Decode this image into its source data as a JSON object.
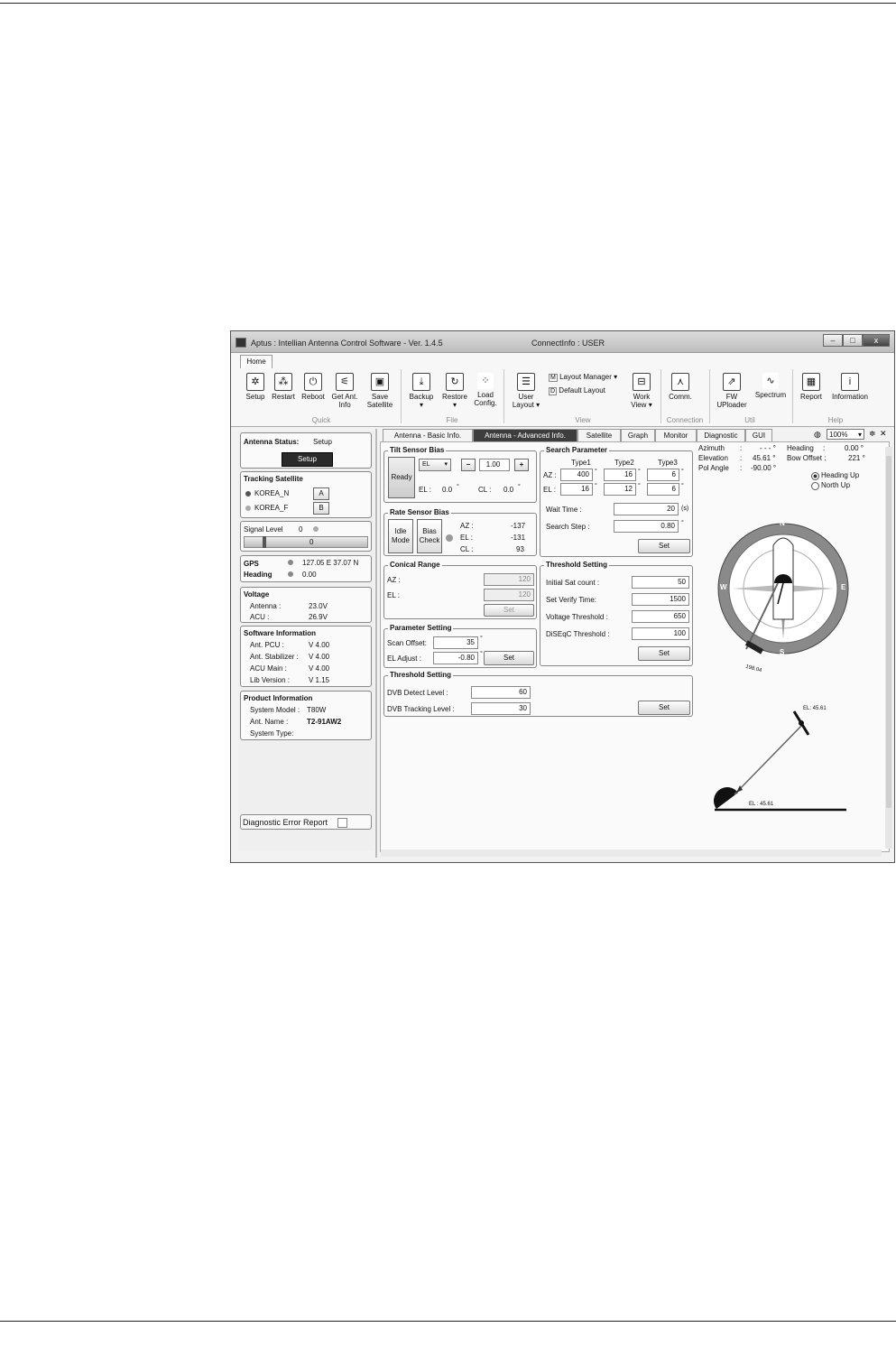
{
  "window": {
    "title": "Aptus : Intellian Antenna Control Software - Ver. 1.4.5",
    "connect_info": "ConnectInfo : USER",
    "btn_min": "–",
    "btn_max": "□",
    "btn_close": "x"
  },
  "ribbon": {
    "tab_home": "Home",
    "quick": {
      "setup": "Setup",
      "restart": "Restart",
      "reboot": "Reboot",
      "get_ant_info_1": "Get Ant.",
      "get_ant_info_2": "Info",
      "save_sat_1": "Save",
      "save_sat_2": "Satellite"
    },
    "file": {
      "backup": "Backup",
      "restore": "Restore",
      "load_1": "Load",
      "load_2": "Config."
    },
    "view": {
      "user_layout_1": "User",
      "user_layout_2": "Layout",
      "layout_manager": "Layout Manager",
      "default_layout": "Default Layout",
      "lm_key": "M",
      "dl_key": "D",
      "work_view_1": "Work",
      "work_view_2": "View"
    },
    "connection": {
      "comm": "Comm."
    },
    "util": {
      "fw_1": "FW",
      "fw_2": "UPloader",
      "spectrum": "Spectrum"
    },
    "help": {
      "report": "Report",
      "information": "Information"
    },
    "groups": {
      "quick": "Quick",
      "file": "File",
      "view": "View",
      "connection": "Connection",
      "util": "Util",
      "help": "Help"
    }
  },
  "left": {
    "antenna_status_label": "Antenna Status:",
    "antenna_status_value": "Setup",
    "setup_button": "Setup",
    "tracking_satellite": "Tracking Satellite",
    "sat_a": "KOREA_N",
    "sat_b": "KOREA_F",
    "btn_a": "A",
    "btn_b": "B",
    "signal_level_label": "Signal Level",
    "signal_level_value": "0",
    "signal_bar_value": "0",
    "gps_label": "GPS",
    "gps_value": "127.05 E  37.07 N",
    "heading_label": "Heading",
    "heading_value": "0.00",
    "voltage": "Voltage",
    "antenna_v_label": "Antenna :",
    "antenna_v": "23.0V",
    "acu_v_label": "ACU :",
    "acu_v": "26.9V",
    "software_info": "Software Information",
    "pcu_label": "Ant. PCU :",
    "pcu": "V 4.00",
    "stab_label": "Ant. Stabilizer :",
    "stab": "V 4.00",
    "acu_main_label": "ACU Main :",
    "acu_main": "V 4.00",
    "lib_label": "Lib Version :",
    "lib": "V 1.15",
    "product_info": "Product Information",
    "model_label": "System Model :",
    "model": "T80W",
    "antname_label": "Ant. Name :",
    "antname": "T2-91AW2",
    "systype_label": "System Type:",
    "diag_error": "Diagnostic Error Report"
  },
  "tabs": [
    "Antenna - Basic Info.",
    "Antenna - Advanced Info.",
    "Satellite",
    "Graph",
    "Monitor",
    "Diagnostic",
    "GUI"
  ],
  "zoom": "100%",
  "tilt": {
    "title": "Tilt Sensor Bias",
    "ready": "Ready",
    "axis": "EL",
    "minus": "−",
    "plus": "+",
    "value": "1.00",
    "el_label": "EL :",
    "el_value": "0.0",
    "cl_label": "CL :",
    "cl_value": "0.0"
  },
  "rate": {
    "title": "Rate Sensor Bias",
    "idle_1": "Idle",
    "idle_2": "Mode",
    "bias_1": "Bias",
    "bias_2": "Check",
    "az_label": "AZ :",
    "az": "-137",
    "el_label": "EL :",
    "el": "-131",
    "cl_label": "CL :",
    "cl": "93"
  },
  "search": {
    "title": "Search Parameter",
    "type1": "Type1",
    "type2": "Type2",
    "type3": "Type3",
    "az_label": "AZ :",
    "el_label": "EL :",
    "az": [
      "400",
      "16",
      "6"
    ],
    "el": [
      "16",
      "12",
      "6"
    ],
    "wait_label": "Wait Time :",
    "wait": "20",
    "wait_unit": "(s)",
    "step_label": "Search Step :",
    "step": "0.80",
    "set": "Set"
  },
  "conical": {
    "title": "Conical Range",
    "az_label": "AZ :",
    "az": "120",
    "el_label": "EL :",
    "el": "120",
    "set": "Set"
  },
  "threshold1": {
    "title": "Threshold Setting",
    "init_label": "Initial Sat count :",
    "init": "50",
    "verify_label": "Set Verify Time:",
    "verify": "1500",
    "voltage_label": "Voltage Threshold :",
    "voltage": "650",
    "diseqc_label": "DiSEqC Threshold :",
    "diseqc": "100",
    "set": "Set"
  },
  "param": {
    "title": "Parameter Setting",
    "scan_label": "Scan Offset:",
    "scan": "35",
    "el_adj_label": "EL Adjust :",
    "el_adj": "-0.80",
    "set": "Set"
  },
  "threshold2": {
    "title": "Threshold Setting",
    "dvb_detect_label": "DVB Detect Level :",
    "dvb_detect": "60",
    "dvb_track_label": "DVB Tracking Level :",
    "dvb_track": "30",
    "set": "Set"
  },
  "info": {
    "azimuth_label": "Azimuth",
    "azimuth": "- - - °",
    "elevation_label": "Elevation",
    "elevation": "45.61 °",
    "pol_label": "Pol Angle",
    "pol": "-90.00 °",
    "heading_label": "Heading",
    "heading": "0.00 °",
    "bow_label": "Bow Offset :",
    "bow": "221 °",
    "heading_up": "Heading Up",
    "north_up": "North Up",
    "compass_n": "N",
    "compass_s": "S",
    "compass_e": "E",
    "compass_w": "W",
    "sat_pos": "198.04",
    "el_sat": "EL: 45.61",
    "el_ground": "EL : 45.61"
  },
  "degree": "°",
  "colon": ":"
}
